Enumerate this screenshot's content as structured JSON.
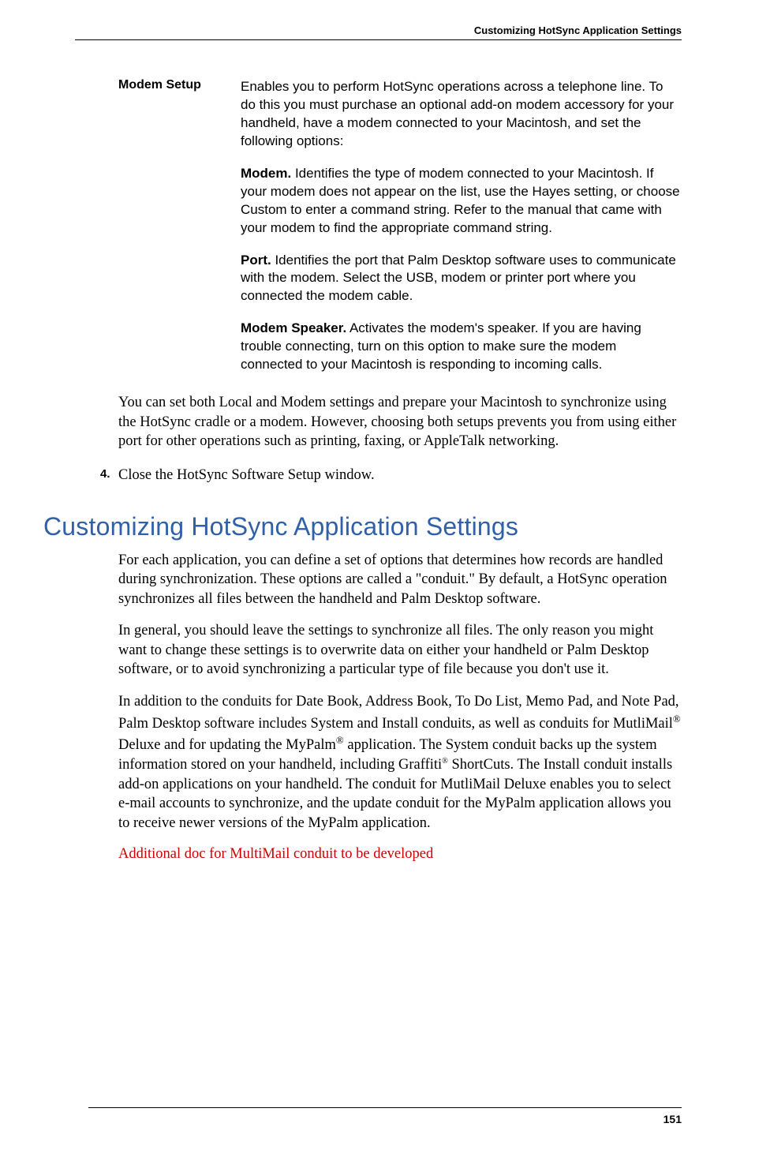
{
  "header": {
    "running_title": "Customizing HotSync Application Settings"
  },
  "definition": {
    "term": "Modem Setup",
    "intro": "Enables you to perform HotSync operations across a telephone line. To do this you must purchase an optional add-on modem accessory for your handheld, have a modem connected to your Macintosh, and set the following options:",
    "sub1_label": "Modem.",
    "sub1_text": " Identifies the type of modem connected to your Macintosh. If your modem does not appear on the list, use the Hayes setting, or choose Custom to enter a command string. Refer to the manual that came with your modem to find the appropriate command string.",
    "sub2_label": "Port.",
    "sub2_text": " Identifies the port that Palm Desktop software uses to communicate with the modem. Select the USB, modem or printer port where you connected the modem cable.",
    "sub3_label": "Modem Speaker.",
    "sub3_text": " Activates the modem's speaker. If you are having trouble connecting, turn on this option to make sure the modem connected to your Macintosh is responding to incoming calls."
  },
  "para_after_def": "You can set both Local and Modem settings and prepare your Macintosh to synchronize using the HotSync cradle or a modem. However, choosing both setups prevents you from using either port for other operations such as printing, faxing, or AppleTalk networking.",
  "step4_num": "4.",
  "step4_text": "Close the HotSync Software Setup window.",
  "heading": "Customizing HotSync Application Settings",
  "p1": "For each application, you can define a set of options that determines how records are handled during synchronization. These options are called a \"conduit.\" By default, a HotSync operation synchronizes all files between the handheld and Palm Desktop software.",
  "p2": "In general, you should leave the settings to synchronize all files. The only reason you might want to change these settings is to overwrite data on either your handheld or Palm Desktop software, or to avoid synchronizing a particular type of file because you don't use it.",
  "p3_a": "In addition to the conduits for Date Book, Address Book, To Do List, Memo Pad, and Note Pad, Palm Desktop software includes System and Install conduits, as well as conduits for MutliMail",
  "p3_b": " Deluxe and for updating the MyPalm",
  "p3_c": " application. The System conduit backs up the system information stored on your handheld, including Graffiti",
  "p3_d": " ShortCuts. The Install conduit installs add-on applications on your handheld. The conduit for MutliMail Deluxe enables you to select e-mail accounts to synchronize, and the update conduit for the MyPalm application allows you to receive newer versions of the MyPalm application.",
  "reg": "®",
  "note": "Additional doc for MultiMail conduit to be developed",
  "page_number": "151"
}
